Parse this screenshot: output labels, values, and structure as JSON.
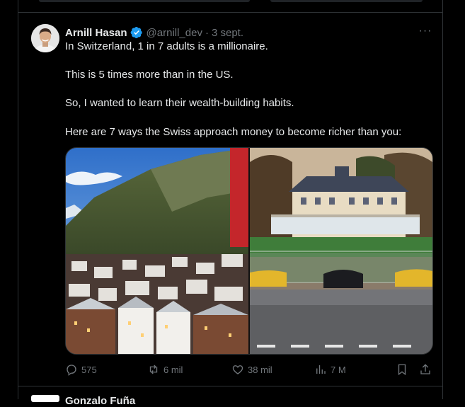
{
  "tweet": {
    "author_name": "Arnill Hasan",
    "author_handle": "@arnill_dev",
    "separator": "·",
    "date": "3 sept.",
    "more_label": "···",
    "lines": [
      "In Switzerland, 1 in 7 adults is a millionaire.",
      "This is 5 times more than in the US.",
      "So, I wanted to learn their wealth-building habits.",
      "Here are 7 ways the Swiss approach money to become richer than you:"
    ],
    "media": [
      {
        "icon": "swiss-village-photo"
      },
      {
        "icon": "mansion-supercars-photo"
      }
    ],
    "actions": {
      "replies": "575",
      "reposts": "6 mil",
      "likes": "38 mil",
      "views": "7 M"
    },
    "accent_color": "#1d9bf0"
  },
  "next_tweet": {
    "author_name_partial": "Gonzalo Fuña"
  }
}
